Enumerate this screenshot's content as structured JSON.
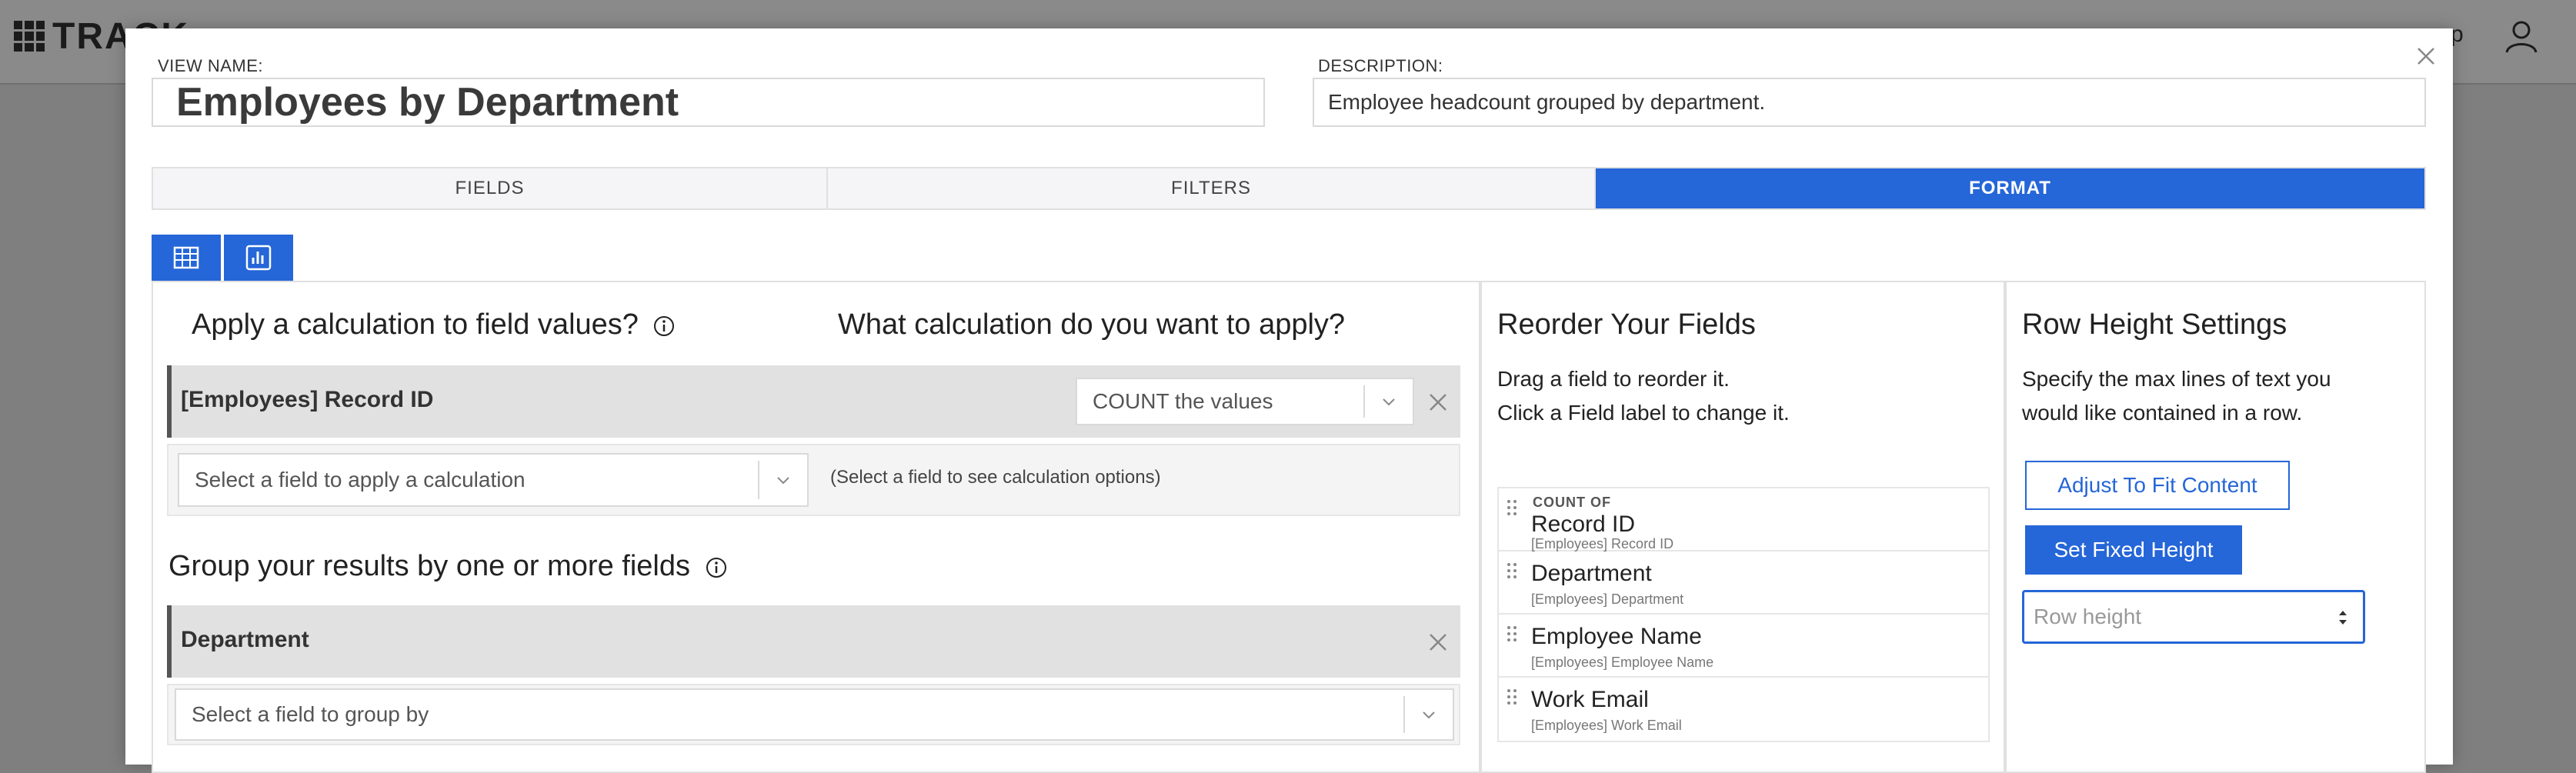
{
  "app": {
    "logo_text": "TRACK",
    "help_label": "p"
  },
  "modal": {
    "view_name_label": "VIEW NAME:",
    "view_name_value": "Employees by Department",
    "description_label": "DESCRIPTION:",
    "description_value": "Employee headcount grouped by department.",
    "tabs": [
      "FIELDS",
      "FILTERS",
      "FORMAT"
    ],
    "active_tab": "FORMAT",
    "view_types": [
      "table-icon",
      "chart-icon"
    ]
  },
  "calc_panel": {
    "heading_apply": "Apply a calculation to field values?",
    "heading_which": "What calculation do you want to apply?",
    "calc_field": {
      "title": "[Employees] Record ID",
      "calculation_value": "COUNT the values"
    },
    "apply_select_placeholder": "Select a field to apply a calculation",
    "apply_hint": "(Select a field to see calculation options)",
    "group_heading": "Group your results by one or more fields",
    "group_field": {
      "title": "Department"
    },
    "group_select_placeholder": "Select a field to group by"
  },
  "reorder_panel": {
    "heading": "Reorder Your Fields",
    "instruction_1": "Drag a field to reorder it.",
    "instruction_2": "Click a Field label to change it.",
    "fields": [
      {
        "prefix": "COUNT OF",
        "label": "Record ID",
        "source": "[Employees] Record ID"
      },
      {
        "prefix": "",
        "label": "Department",
        "source": "[Employees] Department"
      },
      {
        "prefix": "",
        "label": "Employee Name",
        "source": "[Employees] Employee Name"
      },
      {
        "prefix": "",
        "label": "Work Email",
        "source": "[Employees] Work Email"
      }
    ]
  },
  "row_height_panel": {
    "heading": "Row Height Settings",
    "desc_1": "Specify the max lines of text you",
    "desc_2": "would like contained in a row.",
    "adjust_button": "Adjust To Fit Content",
    "fixed_button": "Set Fixed Height",
    "row_height_placeholder": "Row height"
  },
  "colors": {
    "accent": "#2566d8",
    "overlay": "#7f7f7f"
  }
}
